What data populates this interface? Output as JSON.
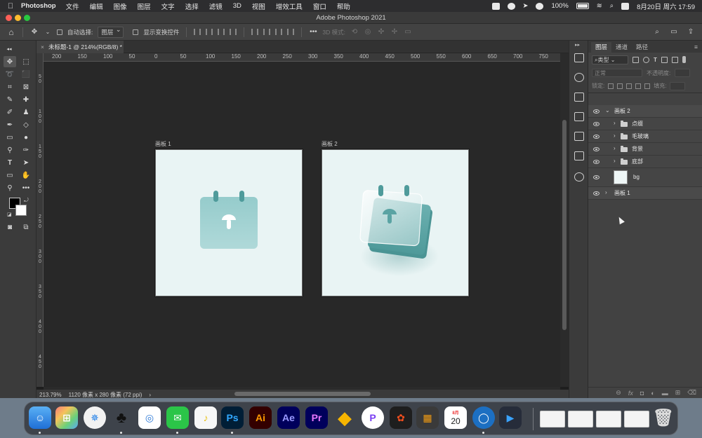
{
  "menubar": {
    "app_name": "Photoshop",
    "items": [
      "文件",
      "编辑",
      "图像",
      "图层",
      "文字",
      "选择",
      "滤镜",
      "3D",
      "视图",
      "增效工具",
      "窗口",
      "帮助"
    ],
    "battery": "100%",
    "datetime": "8月20日 周六  17:59"
  },
  "window": {
    "title": "Adobe Photoshop 2021"
  },
  "options": {
    "auto_select_label": "自动选择:",
    "auto_select_value": "图层",
    "show_transform_label": "显示变换控件",
    "mode_3d_label": "3D 模式:"
  },
  "document": {
    "tab_label": "未标题-1 @ 214%(RGB/8) *"
  },
  "ruler": {
    "top_ticks": [
      "200",
      "150",
      "100",
      "50",
      "0",
      "50",
      "100",
      "150",
      "200",
      "250",
      "300",
      "350",
      "400",
      "450",
      "500",
      "550",
      "600",
      "650",
      "700",
      "750"
    ],
    "left_ticks": [
      "5\n0",
      "1\n0\n0",
      "1\n5\n0",
      "2\n0\n0",
      "2\n5\n0",
      "3\n0\n0",
      "3\n5\n0",
      "4\n0\n0",
      "4\n5\n0"
    ]
  },
  "artboards": [
    {
      "label": "画板 1"
    },
    {
      "label": "画板 2"
    }
  ],
  "status": {
    "zoom": "213.79%",
    "doc_size": "1120 像素 x 280 像素 (72 ppi)",
    "arrow": "›"
  },
  "layers_panel": {
    "tabs": [
      "图层",
      "通道",
      "路径"
    ],
    "filter_label": "类型",
    "blend_mode": "正常",
    "opacity_label": "不透明度:",
    "lock_label": "锁定:",
    "fill_label": "填充:",
    "rows": [
      {
        "name": "画板 2"
      },
      {
        "name": "点缀"
      },
      {
        "name": "毛玻璃"
      },
      {
        "name": "背景"
      },
      {
        "name": "底部"
      },
      {
        "name": "bg"
      },
      {
        "name": "画板 1"
      }
    ]
  },
  "dock": {
    "labels": {
      "ps": "Ps",
      "ai": "Ai",
      "ae": "Ae",
      "pr": "Pr"
    },
    "calendar_month": "8月",
    "calendar_day": "20"
  },
  "colors": {
    "teal": "#6fb3b3",
    "teal_dark": "#4e9999",
    "artboard_bg": "#e9f4f4",
    "ui_dark": "#424242"
  }
}
